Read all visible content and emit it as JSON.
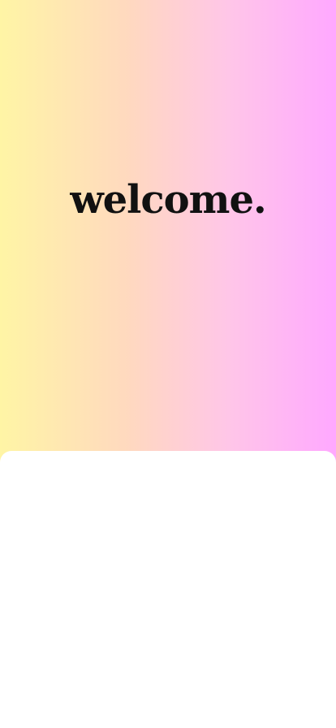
{
  "screen": {
    "title": "welcome."
  },
  "colors": {
    "gradient_left": "#fff5a5",
    "gradient_mid_left": "#ffd9bf",
    "gradient_mid_right": "#ffc6e8",
    "gradient_right": "#ffa8ff",
    "title_text": "#111111",
    "sheet_background": "#ffffff"
  }
}
